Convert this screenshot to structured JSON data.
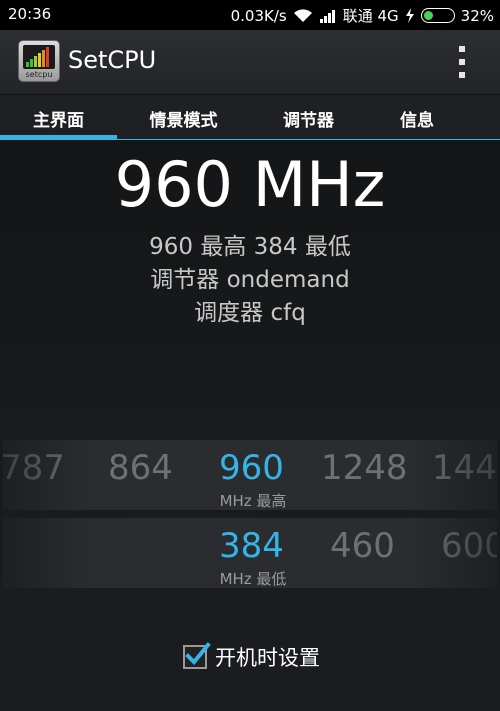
{
  "status_bar": {
    "time": "20:36",
    "net_speed": "0.03K/s",
    "carrier": "联通 4G",
    "battery": "32%",
    "battery_level": 0.32,
    "accent": "#49d34e"
  },
  "app": {
    "title": "SetCPU",
    "icon_label": "setcpu"
  },
  "tabs": [
    {
      "label": "主界面",
      "active": true
    },
    {
      "label": "情景模式",
      "active": false
    },
    {
      "label": "调节器",
      "active": false
    },
    {
      "label": "信息",
      "active": false
    }
  ],
  "main": {
    "current_freq": "960 MHz",
    "range_line": "960 最高 384 最低",
    "governor_line": "调节器 ondemand",
    "scheduler_line": "调度器 cfq"
  },
  "max_picker": {
    "values": [
      "787",
      "864",
      "960",
      "1248",
      "144"
    ],
    "selected": "960",
    "unit_label": "MHz 最高"
  },
  "min_picker": {
    "values": [
      "384",
      "460",
      "600"
    ],
    "selected": "384",
    "unit_label": "MHz 最低"
  },
  "set_on_boot": {
    "label": "开机时设置",
    "checked": true
  },
  "colors": {
    "accent": "#35b5e5",
    "background": "#141517"
  }
}
